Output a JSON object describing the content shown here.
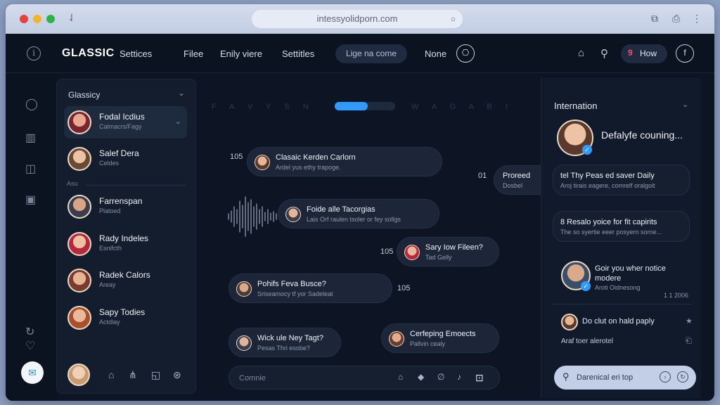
{
  "browser": {
    "url": "intessyolidporn.com"
  },
  "topnav": {
    "brand": "GLASSIC",
    "links": [
      "Settices",
      "Filee",
      "Enily viere",
      "Settitles"
    ],
    "pill_label": "Lige na come",
    "none_label": "None",
    "how_label": "How"
  },
  "contacts": {
    "header": "Glassicy",
    "section_label": "Asu",
    "items": [
      {
        "name": "Fodal Icdius",
        "sub": "Calmacrs/Fagy"
      },
      {
        "name": "Salef Dera",
        "sub": "Celdes"
      },
      {
        "name": "Farrenspan",
        "sub": "Platoed"
      },
      {
        "name": "Rady Indeles",
        "sub": "Esnifcth"
      },
      {
        "name": "Radek Calors",
        "sub": "Areay"
      },
      {
        "name": "Sapy Todies",
        "sub": "Actdlay"
      }
    ]
  },
  "chat": {
    "faded_left": "F A V Y S N",
    "faded_right": "W A G A B I",
    "messages": [
      {
        "title": "Clasaic Kerden Carlorn",
        "sub": "Ardel yus ethy trapoge.",
        "time": "105"
      },
      {
        "title": "Proreed",
        "sub": "Dosbel",
        "time": "01"
      },
      {
        "title": "Foide alle Tacorgias",
        "sub": "Lais Orf raulen tsoler or fey sollgs",
        "time": ""
      },
      {
        "title": "Sary Iow Fileen?",
        "sub": "Tad Gelly",
        "time": "105"
      },
      {
        "title": "Pohifs Feva Busce?",
        "sub": "Sriseamocy tf yor Sadeleat",
        "time": "105"
      },
      {
        "title": "Wick ule Ney Tagt?",
        "sub": "Pesas Thri esobe?",
        "time": ""
      },
      {
        "title": "Cerfeping Emoects",
        "sub": "Pallvin cealy",
        "time": ""
      }
    ],
    "composer_placeholder": "Comnie"
  },
  "right_panel": {
    "header": "Internation",
    "profile_name": "Defalyfe couning...",
    "cards": [
      {
        "title": "tel Thy Peas ed saver Daily",
        "sub": "Aroj tirais eagere, comrelf oralgoit"
      },
      {
        "title": "8 Resalo yoice for fit capirits",
        "sub": "The so syertie eeer posyern sorne..."
      }
    ],
    "feed_title": "Goir you wher notice",
    "feed_title2": "modere",
    "feed_sub": "Aroti Oidnesong",
    "feed_meta": "1 1 2006",
    "reply_text": "Do clut on hald paply",
    "events_text": "Araf toer alerotel",
    "search_placeholder": "Darenical eri top"
  }
}
